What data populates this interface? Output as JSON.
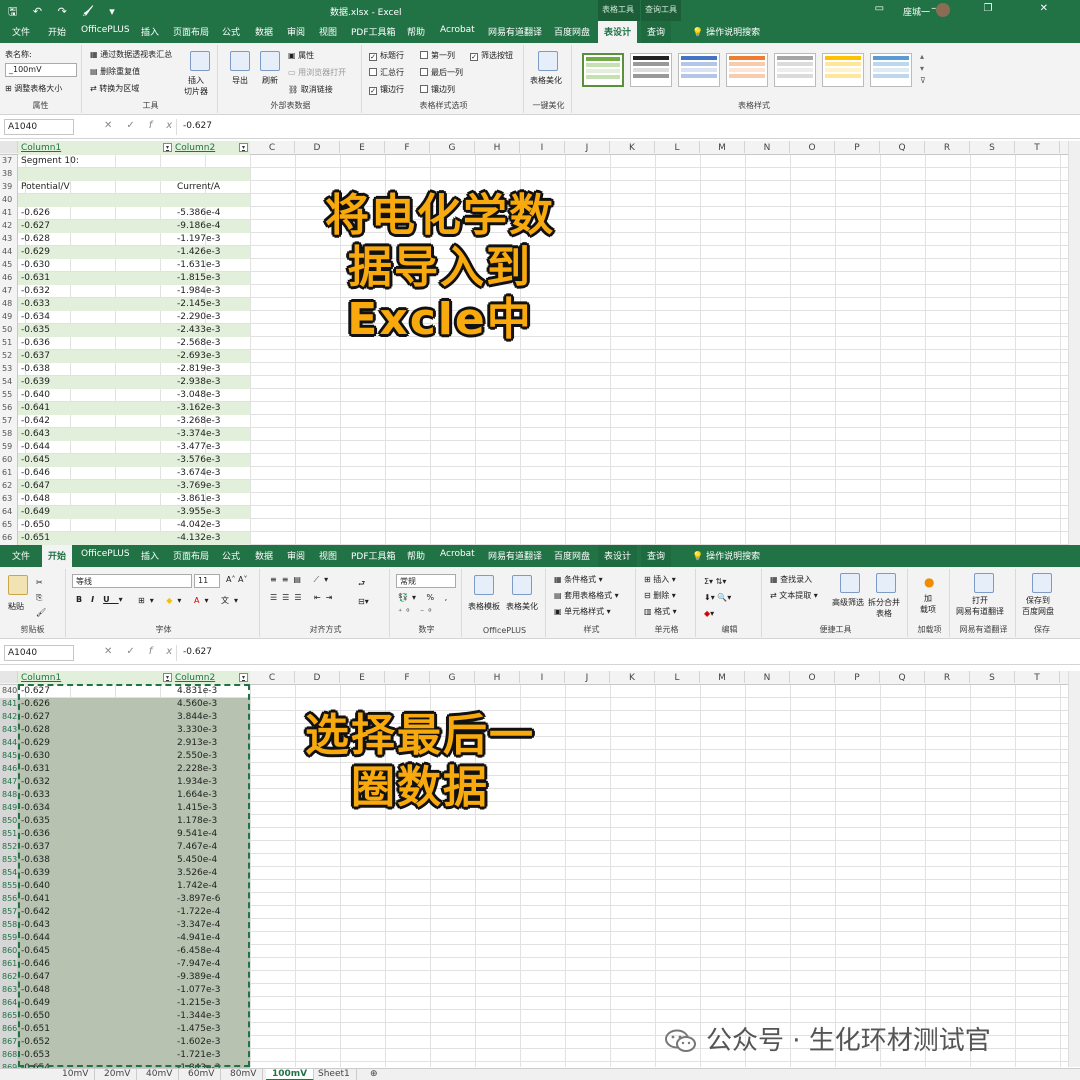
{
  "panel1": {
    "title_bar": {
      "quick_access": "🖫 ↶ ↷ 🖌 ▾",
      "window_title": "数据.xlsx  -  Excel",
      "context_group_1": "表格工具",
      "context_group_2": "查询工具",
      "user": "座城一",
      "controls": "▭ – ❐ ✕"
    },
    "tabs": [
      "文件",
      "开始",
      "OfficePLUS",
      "插入",
      "页面布局",
      "公式",
      "数据",
      "审阅",
      "视图",
      "PDF工具箱",
      "帮助",
      "Acrobat",
      "网易有道翻译",
      "百度网盘"
    ],
    "active_tab": "表设计",
    "query_tab": "查询",
    "tell_me": "操作说明搜索",
    "ribbon": {
      "table_name_label": "表名称:",
      "table_name_value": "_100mV",
      "resize_table": "调整表格大小",
      "group_properties": "属性",
      "summarize_pivot": "通过数据透视表汇总",
      "remove_duplicates": "删除重复值",
      "convert_to_range": "转换为区域",
      "insert_slicer": "插入\n切片器",
      "group_tools": "工具",
      "export": "导出",
      "refresh": "刷新",
      "properties_btn": "属性",
      "open_browser": "用浏览器打开",
      "unlink": "取消链接",
      "group_external": "外部表数据",
      "opt_header_row": "标题行",
      "opt_total_row": "汇总行",
      "opt_banded_rows": "镶边行",
      "opt_first_col": "第一列",
      "opt_last_col": "最后一列",
      "opt_banded_cols": "镶边列",
      "opt_filter_btn": "筛选按钮",
      "group_style_options": "表格样式选项",
      "beautify": "表格美化",
      "group_beautify": "一键美化",
      "group_styles": "表格样式"
    },
    "formula": {
      "name_box": "A1040",
      "value": "-0.627"
    },
    "columns": [
      "C",
      "D",
      "E",
      "F",
      "G",
      "H",
      "I",
      "J",
      "K",
      "L",
      "M",
      "N",
      "O",
      "P",
      "Q",
      "R",
      "S",
      "T"
    ],
    "table_headers": [
      "Column1",
      "Column2"
    ],
    "rows": [
      {
        "n": "37",
        "a": "Segment 10:",
        "b": ""
      },
      {
        "n": "38",
        "a": "",
        "b": ""
      },
      {
        "n": "39",
        "a": "Potential/V",
        "b": "Current/A"
      },
      {
        "n": "40",
        "a": "",
        "b": ""
      },
      {
        "n": "41",
        "a": "-0.626",
        "b": "-5.386e-4"
      },
      {
        "n": "42",
        "a": "-0.627",
        "b": "-9.186e-4"
      },
      {
        "n": "43",
        "a": "-0.628",
        "b": "-1.197e-3"
      },
      {
        "n": "44",
        "a": "-0.629",
        "b": "-1.426e-3"
      },
      {
        "n": "45",
        "a": "-0.630",
        "b": "-1.631e-3"
      },
      {
        "n": "46",
        "a": "-0.631",
        "b": "-1.815e-3"
      },
      {
        "n": "47",
        "a": "-0.632",
        "b": "-1.984e-3"
      },
      {
        "n": "48",
        "a": "-0.633",
        "b": "-2.145e-3"
      },
      {
        "n": "49",
        "a": "-0.634",
        "b": "-2.290e-3"
      },
      {
        "n": "50",
        "a": "-0.635",
        "b": "-2.433e-3"
      },
      {
        "n": "51",
        "a": "-0.636",
        "b": "-2.568e-3"
      },
      {
        "n": "52",
        "a": "-0.637",
        "b": "-2.693e-3"
      },
      {
        "n": "53",
        "a": "-0.638",
        "b": "-2.819e-3"
      },
      {
        "n": "54",
        "a": "-0.639",
        "b": "-2.938e-3"
      },
      {
        "n": "55",
        "a": "-0.640",
        "b": "-3.048e-3"
      },
      {
        "n": "56",
        "a": "-0.641",
        "b": "-3.162e-3"
      },
      {
        "n": "57",
        "a": "-0.642",
        "b": "-3.268e-3"
      },
      {
        "n": "58",
        "a": "-0.643",
        "b": "-3.374e-3"
      },
      {
        "n": "59",
        "a": "-0.644",
        "b": "-3.477e-3"
      },
      {
        "n": "60",
        "a": "-0.645",
        "b": "-3.576e-3"
      },
      {
        "n": "61",
        "a": "-0.646",
        "b": "-3.674e-3"
      },
      {
        "n": "62",
        "a": "-0.647",
        "b": "-3.769e-3"
      },
      {
        "n": "63",
        "a": "-0.648",
        "b": "-3.861e-3"
      },
      {
        "n": "64",
        "a": "-0.649",
        "b": "-3.955e-3"
      },
      {
        "n": "65",
        "a": "-0.650",
        "b": "-4.042e-3"
      },
      {
        "n": "66",
        "a": "-0.651",
        "b": "-4.132e-3"
      }
    ],
    "overlay_lines": [
      "将电化学数",
      "据导入到",
      "Excle中"
    ]
  },
  "panel2": {
    "tabs": [
      "文件",
      "OfficePLUS",
      "插入",
      "页面布局",
      "公式",
      "数据",
      "审阅",
      "视图",
      "PDF工具箱",
      "帮助",
      "Acrobat",
      "网易有道翻译",
      "百度网盘",
      "表设计"
    ],
    "active_tab": "开始",
    "query_tab": "查询",
    "tell_me": "操作说明搜索",
    "ribbon": {
      "paste": "粘贴",
      "group_clipboard": "剪贴板",
      "font_name": "等线",
      "font_size": "11",
      "group_font": "字体",
      "group_align": "对齐方式",
      "number_format": "常规",
      "group_number": "数字",
      "table_template": "表格模板",
      "table_beautify": "表格美化",
      "group_officeplus": "OfficePLUS",
      "cond_format": "条件格式",
      "format_as_table": "套用表格格式",
      "cell_styles": "单元格样式",
      "group_styles": "样式",
      "insert": "插入",
      "delete": "删除",
      "format": "格式",
      "group_cells": "单元格",
      "group_edit": "编辑",
      "find_entry": "查找录入",
      "text_extract": "文本提取",
      "adv_filter": "高级筛选",
      "split_merge": "拆分合并\n表格",
      "group_quicktools": "便捷工具",
      "addin": "加\n载项",
      "group_addin": "加载项",
      "open_youdao": "打开\n网易有道翻译",
      "group_youdao": "网易有道翻译",
      "save_baidu": "保存到\n百度网盘",
      "group_save": "保存"
    },
    "formula": {
      "name_box": "A1040",
      "value": "-0.627"
    },
    "columns": [
      "C",
      "D",
      "E",
      "F",
      "G",
      "H",
      "I",
      "J",
      "K",
      "L",
      "M",
      "N",
      "O",
      "P",
      "Q",
      "R",
      "S",
      "T"
    ],
    "table_headers": [
      "Column1",
      "Column2"
    ],
    "rows": [
      {
        "n": "840",
        "a": "-0.627",
        "b": "4.831e-3"
      },
      {
        "n": "841",
        "a": "-0.626",
        "b": "4.560e-3"
      },
      {
        "n": "842",
        "a": "-0.627",
        "b": "3.844e-3"
      },
      {
        "n": "843",
        "a": "-0.628",
        "b": "3.330e-3"
      },
      {
        "n": "844",
        "a": "-0.629",
        "b": "2.913e-3"
      },
      {
        "n": "845",
        "a": "-0.630",
        "b": "2.550e-3"
      },
      {
        "n": "846",
        "a": "-0.631",
        "b": "2.228e-3"
      },
      {
        "n": "847",
        "a": "-0.632",
        "b": "1.934e-3"
      },
      {
        "n": "848",
        "a": "-0.633",
        "b": "1.664e-3"
      },
      {
        "n": "849",
        "a": "-0.634",
        "b": "1.415e-3"
      },
      {
        "n": "850",
        "a": "-0.635",
        "b": "1.178e-3"
      },
      {
        "n": "851",
        "a": "-0.636",
        "b": "9.541e-4"
      },
      {
        "n": "852",
        "a": "-0.637",
        "b": "7.467e-4"
      },
      {
        "n": "853",
        "a": "-0.638",
        "b": "5.450e-4"
      },
      {
        "n": "854",
        "a": "-0.639",
        "b": "3.526e-4"
      },
      {
        "n": "855",
        "a": "-0.640",
        "b": "1.742e-4"
      },
      {
        "n": "856",
        "a": "-0.641",
        "b": "-3.897e-6"
      },
      {
        "n": "857",
        "a": "-0.642",
        "b": "-1.722e-4"
      },
      {
        "n": "858",
        "a": "-0.643",
        "b": "-3.347e-4"
      },
      {
        "n": "859",
        "a": "-0.644",
        "b": "-4.941e-4"
      },
      {
        "n": "860",
        "a": "-0.645",
        "b": "-6.458e-4"
      },
      {
        "n": "861",
        "a": "-0.646",
        "b": "-7.947e-4"
      },
      {
        "n": "862",
        "a": "-0.647",
        "b": "-9.389e-4"
      },
      {
        "n": "863",
        "a": "-0.648",
        "b": "-1.077e-3"
      },
      {
        "n": "864",
        "a": "-0.649",
        "b": "-1.215e-3"
      },
      {
        "n": "865",
        "a": "-0.650",
        "b": "-1.344e-3"
      },
      {
        "n": "866",
        "a": "-0.651",
        "b": "-1.475e-3"
      },
      {
        "n": "867",
        "a": "-0.652",
        "b": "-1.602e-3"
      },
      {
        "n": "868",
        "a": "-0.653",
        "b": "-1.721e-3"
      },
      {
        "n": "869",
        "a": "-0.654",
        "b": "-1.843e-3"
      }
    ],
    "sheet_tabs": [
      "10mV",
      "20mV",
      "40mV",
      "60mV",
      "80mV",
      "100mV",
      "Sheet1"
    ],
    "active_sheet": "100mV",
    "overlay_lines": [
      "选择最后一",
      "圈数据"
    ]
  },
  "watermark": "公众号 · 生化环材测试官",
  "colors": {
    "excel_green": "#217346",
    "band": "#e2efda",
    "selection": "#b7c3b0",
    "overlay": "#f7a90d"
  }
}
